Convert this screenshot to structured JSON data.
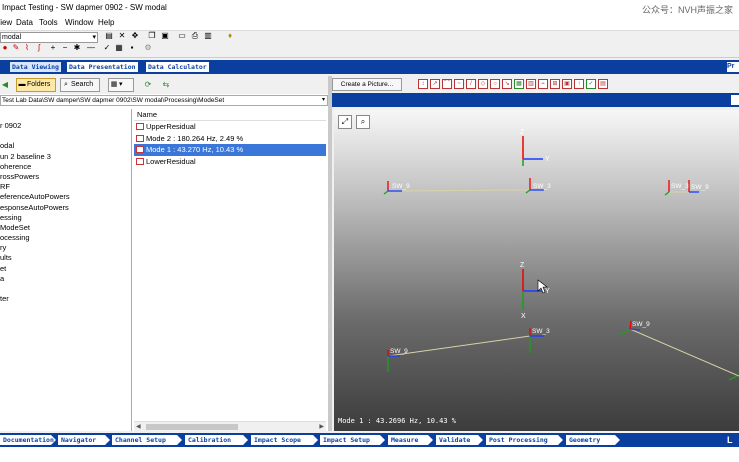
{
  "window": {
    "title": "Impact Testing - SW dapmer 0902 - SW modal",
    "watermark": "公众号：NVH声振之家"
  },
  "menu": [
    "View",
    "Data",
    "Tools",
    "Window",
    "Help"
  ],
  "toolbar": {
    "combo_value": "modal"
  },
  "tabs": [
    "Data Viewing",
    "Data Presentation",
    "Data Calculator"
  ],
  "tab_right": "Pr",
  "navigator": {
    "folders_label": "Folders",
    "search_label": "Search",
    "path": "Test Lab Data\\SW damper\\SW dapmer 0902\\SW modal\\Processing\\ModeSet",
    "tree": [
      "r 0902",
      "",
      "odal",
      "un 2 baseline 3",
      "oherence",
      "rossPowers",
      "RF",
      "eferenceAutoPowers",
      "esponseAutoPowers",
      "essing",
      "ModeSet",
      "ocessing",
      "ry",
      "ults",
      "et",
      "a",
      "",
      "ter"
    ],
    "list_header": "Name",
    "list": [
      {
        "label": "UpperResidual",
        "selected": false
      },
      {
        "label": "Mode  2 : 180.264 Hz, 2.49 %",
        "selected": false
      },
      {
        "label": "Mode  1 : 43.270 Hz, 10.43 %",
        "selected": true
      },
      {
        "label": "LowerResidual",
        "selected": false
      }
    ]
  },
  "view": {
    "create_picture_label": "Create a Picture...",
    "readout": "Mode  1 : 43.2696 Hz, 10.43 %",
    "node_label_sw9": "SW_9",
    "node_label_sw3": "SW_3",
    "axis_x": "X",
    "axis_y": "Y",
    "axis_z": "Z"
  },
  "workflow": [
    "Documentation",
    "Navigator",
    "Channel Setup",
    "Calibration",
    "Impact Scope",
    "Impact Setup",
    "Measure",
    "Validate",
    "Post Processing",
    "Geometry"
  ],
  "workflow_end": "L",
  "colors": {
    "brand_blue": "#0a3fa0",
    "selection": "#3b77d8"
  }
}
